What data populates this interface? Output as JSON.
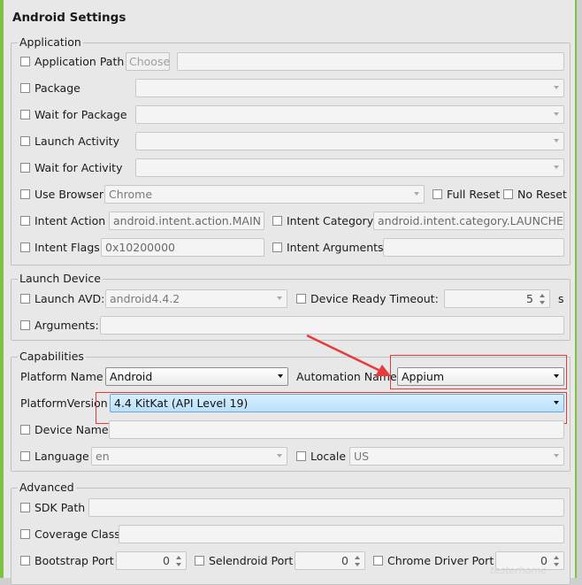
{
  "title": "Android Settings",
  "application": {
    "legend": "Application",
    "app_path_label": "Application Path",
    "choose_label": "Choose",
    "app_path_value": "",
    "package_label": "Package",
    "package_value": "",
    "wait_package_label": "Wait for Package",
    "wait_package_value": "",
    "launch_activity_label": "Launch Activity",
    "launch_activity_value": "",
    "wait_activity_label": "Wait for Activity",
    "wait_activity_value": "",
    "use_browser_label": "Use Browser",
    "browser_value": "Chrome",
    "full_reset_label": "Full Reset",
    "no_reset_label": "No Reset",
    "intent_action_label": "Intent Action",
    "intent_action_value": "android.intent.action.MAIN",
    "intent_category_label": "Intent Category",
    "intent_category_value": "android.intent.category.LAUNCHER",
    "intent_flags_label": "Intent Flags",
    "intent_flags_value": "0x10200000",
    "intent_args_label": "Intent Arguments",
    "intent_args_value": ""
  },
  "launch_device": {
    "legend": "Launch Device",
    "launch_avd_label": "Launch AVD:",
    "avd_value": "android4.4.2",
    "ready_timeout_label": "Device Ready Timeout:",
    "ready_timeout_value": "5",
    "seconds_unit": "s",
    "arguments_label": "Arguments:",
    "arguments_value": ""
  },
  "capabilities": {
    "legend": "Capabilities",
    "platform_name_label": "Platform Name",
    "platform_name_value": "Android",
    "automation_name_label": "Automation Name",
    "automation_name_value": "Appium",
    "platform_version_label": "PlatformVersion",
    "platform_version_value": "4.4 KitKat (API Level 19)",
    "device_name_label": "Device Name",
    "device_name_value": "",
    "language_label": "Language",
    "language_value": "en",
    "locale_label": "Locale",
    "locale_value": "US"
  },
  "advanced": {
    "legend": "Advanced",
    "sdk_path_label": "SDK Path",
    "sdk_path_value": "",
    "coverage_class_label": "Coverage Class",
    "coverage_class_value": "",
    "bootstrap_port_label": "Bootstrap Port",
    "bootstrap_port_value": "0",
    "selendroid_port_label": "Selendroid Port",
    "selendroid_port_value": "0",
    "chrome_driver_port_label": "Chrome Driver Port",
    "chrome_driver_port_value": "0"
  },
  "watermark": "testerhome",
  "colors": {
    "frame_accent": "#7dc243",
    "highlight_box": "#e23b3b",
    "arrow": "#e83a3a",
    "selected_dropdown": "#b9e0fb"
  }
}
